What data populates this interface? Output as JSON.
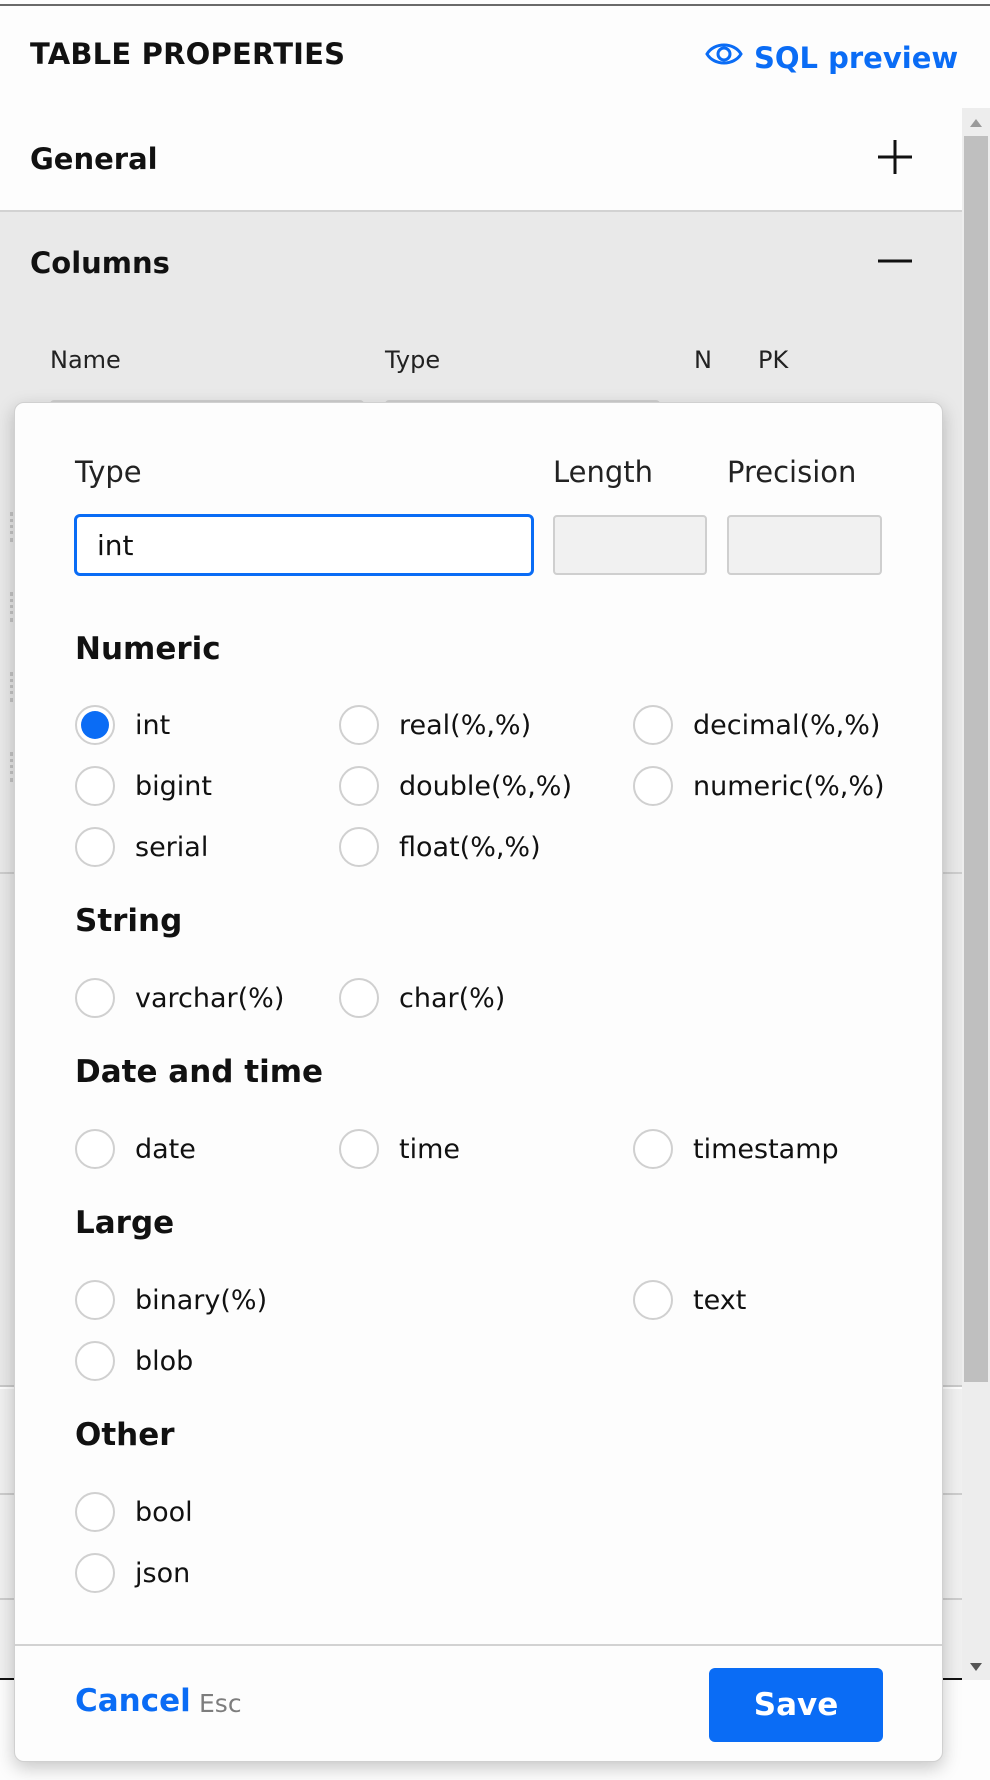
{
  "header": {
    "title": "TABLE PROPERTIES",
    "sql_preview_label": "SQL preview",
    "sql_preview_icon": "eye-icon"
  },
  "sections": {
    "general": {
      "label": "General",
      "state": "collapsed",
      "toggle_icon": "plus-icon"
    },
    "columns": {
      "label": "Columns",
      "state": "expanded",
      "toggle_icon": "minus-icon",
      "headers": [
        "Name",
        "Type",
        "N",
        "PK"
      ]
    }
  },
  "type_popover": {
    "type_label": "Type",
    "type_value": "int",
    "length_label": "Length",
    "length_value": "",
    "precision_label": "Precision",
    "precision_value": "",
    "selected": "int",
    "groups": [
      {
        "title": "Numeric",
        "options": [
          "int",
          "real(%,%)",
          "decimal(%,%)",
          "bigint",
          "double(%,%)",
          "numeric(%,%)",
          "serial",
          "float(%,%)"
        ]
      },
      {
        "title": "String",
        "options": [
          "varchar(%)",
          "char(%)"
        ]
      },
      {
        "title": "Date and time",
        "options": [
          "date",
          "time",
          "timestamp"
        ]
      },
      {
        "title": "Large",
        "options": [
          "binary(%)",
          "text",
          "blob"
        ]
      },
      {
        "title": "Other",
        "options": [
          "bool",
          "json"
        ]
      }
    ],
    "cancel_label": "Cancel",
    "cancel_shortcut": "Esc",
    "save_label": "Save"
  },
  "colors": {
    "accent": "#0a6cf5",
    "section_bg": "#e9e9e9",
    "radio_border": "#d0d0d0"
  }
}
